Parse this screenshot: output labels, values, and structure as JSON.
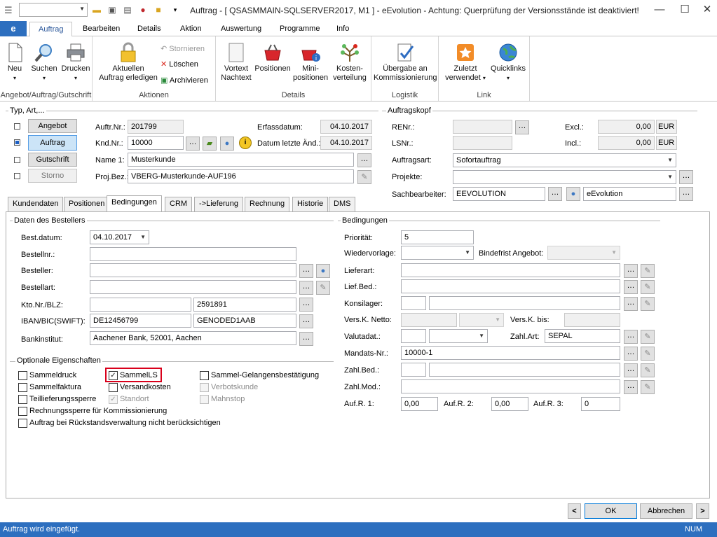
{
  "window": {
    "title": "Auftrag - [ QSASMMAIN-SQLSERVER2017, M1 ]  -  eEvolution - Achtung: Querprüfung der Versionsstände ist deaktiviert!",
    "buttons": {
      "minimize": "—",
      "maximize": "☐",
      "close": "✕"
    }
  },
  "ribbon_tabs": [
    "Auftrag",
    "Bearbeiten",
    "Details",
    "Aktion",
    "Auswertung",
    "Programme",
    "Info"
  ],
  "ribbon": {
    "groups": {
      "g1": "Angebot/Auftrag/Gutschrift",
      "g2": "Aktionen",
      "g3": "Details",
      "g4": "Logistik",
      "g5": "Link"
    },
    "neu": "Neu",
    "suchen": "Suchen",
    "drucken": "Drucken",
    "aktuellen1": "Aktuellen",
    "aktuellen2": "Auftrag erledigen",
    "stornieren": "Stornieren",
    "loeschen": "Löschen",
    "archivieren": "Archivieren",
    "vortext1": "Vortext",
    "vortext2": "Nachtext",
    "positionen": "Positionen",
    "mini1": "Mini-",
    "mini2": "positionen",
    "kosten1": "Kosten-",
    "kosten2": "verteilung",
    "uebergabe1": "Übergabe an",
    "uebergabe2": "Kommissionierung",
    "zuletzt1": "Zuletzt",
    "zuletzt2": "verwendet",
    "quicklinks": "Quicklinks"
  },
  "typ": {
    "legend": "Typ, Art,...",
    "angebot": "Angebot",
    "auftrag": "Auftrag",
    "gutschrift": "Gutschrift",
    "storno": "Storno",
    "auftr_nr_label": "Auftr.Nr.:",
    "auftr_nr": "201799",
    "knd_nr_label": "Knd.Nr.:",
    "knd_nr": "10000",
    "name1_label": "Name 1:",
    "name1": "Musterkunde",
    "projbez_label": "Proj.Bez.:",
    "projbez": "VBERG-Musterkunde-AUF196",
    "erfassdatum_label": "Erfassdatum:",
    "erfassdatum": "04.10.2017",
    "datum_label": "Datum letzte Änd.:",
    "datum": "04.10.2017"
  },
  "kopf": {
    "legend": "Auftragskopf",
    "renr_label": "RENr.:",
    "renr": "",
    "lsnr_label": "LSNr.:",
    "lsnr": "",
    "excl_label": "Excl.:",
    "excl": "0,00",
    "excl_cur": "EUR",
    "incl_label": "Incl.:",
    "incl": "0,00",
    "incl_cur": "EUR",
    "auftragsart_label": "Auftragsart:",
    "auftragsart": "Sofortauftrag",
    "projekte_label": "Projekte:",
    "projekte": "",
    "sb_label": "Sachbearbeiter:",
    "sb": "EEVOLUTION",
    "sb_name": "eEvolution"
  },
  "tabs": [
    "Kundendaten",
    "Positionen",
    "Bedingungen",
    "CRM",
    "->Lieferung",
    "Rechnung",
    "Historie",
    "DMS"
  ],
  "besteller": {
    "legend": "Daten des Bestellers",
    "bestdatum_label": "Best.datum:",
    "bestdatum": "04.10.2017",
    "bestellnr_label": "Bestellnr.:",
    "bestellnr": "",
    "besteller_label": "Besteller:",
    "besteller": "",
    "bestellart_label": "Bestellart:",
    "bestellart": "",
    "kto_label": "Kto.Nr./BLZ:",
    "kto": "",
    "blz": "2591891",
    "iban_label": "IBAN/BIC(SWIFT):",
    "iban": "DE12456799",
    "bic": "GENODED1AAB",
    "bank_label": "Bankinstitut:",
    "bank": "Aachener Bank, 52001, Aachen"
  },
  "optionen": {
    "legend": "Optionale Eigenschaften",
    "sammeldruck": "Sammeldruck",
    "sammelfaktura": "Sammelfaktura",
    "teillieferungssperre": "Teillieferungssperre",
    "rechnungssperre": "Rechnungssperre für Kommissionierung",
    "rueckstand": "Auftrag bei Rückstandsverwaltung nicht berücksichtigen",
    "sammells": "SammelLS",
    "versandkosten": "Versandkosten",
    "standort": "Standort",
    "sammelgelangen": "Sammel-Gelangensbestätigung",
    "verbotskunde": "Verbotskunde",
    "mahnstop": "Mahnstop"
  },
  "bedingungen": {
    "legend": "Bedingungen",
    "prioritaet_label": "Priorität:",
    "prioritaet": "5",
    "wiedervorlage_label": "Wiedervorlage:",
    "wiedervorlage": "",
    "bindefrist_label": "Bindefrist Angebot:",
    "bindefrist": "",
    "lieferart_label": "Lieferart:",
    "lieferart": "",
    "liefbed_label": "Lief.Bed.:",
    "liefbed": "",
    "konsilager_label": "Konsilager:",
    "konsilager": "",
    "verskn_label": "Vers.K. Netto:",
    "verskn": "",
    "verskbis_label": "Vers.K. bis:",
    "verskbis": "",
    "valutadat_label": "Valutadat.:",
    "valutadat": "",
    "zahlart_label": "Zahl.Art:",
    "zahlart": "SEPAL",
    "mandats_label": "Mandats-Nr.:",
    "mandats": "10000-1",
    "zahlbed_label": "Zahl.Bed.:",
    "zahlbed": "",
    "zahlmod_label": "Zahl.Mod.:",
    "zahlmod": "",
    "aufr1_label": "Auf.R. 1:",
    "aufr1": "0,00",
    "aufr2_label": "Auf.R. 2:",
    "aufr2": "0,00",
    "aufr3_label": "Auf.R. 3:",
    "aufr3": "0"
  },
  "footer": {
    "prev": "<",
    "ok": "OK",
    "cancel": "Abbrechen",
    "next": ">"
  },
  "statusbar": {
    "text": "Auftrag wird eingefügt.",
    "num": "NUM"
  }
}
